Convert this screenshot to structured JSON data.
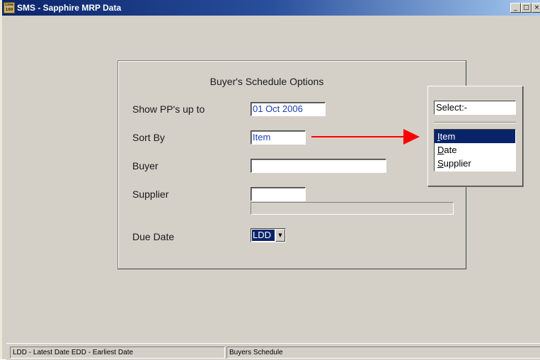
{
  "window": {
    "title": "SMS - Sapphire MRP Data",
    "icon_text": "Line 100",
    "controls": {
      "minimize": "_",
      "maximize": "□",
      "close": "×"
    }
  },
  "dialog": {
    "title": "Buyer's Schedule Options",
    "show_pp_label": "Show PP's up to",
    "show_pp_value": "01 Oct 2006",
    "sort_by_label": "Sort By",
    "sort_by_value": "Item",
    "buyer_label": "Buyer",
    "buyer_value": "",
    "supplier_label": "Supplier",
    "supplier_value": "",
    "supplier_name_value": "",
    "due_date_label": "Due Date",
    "due_date_value": "LDD"
  },
  "popup": {
    "header": "Select:-",
    "items": [
      "Item",
      "Date",
      "Supplier"
    ],
    "selected": "Item"
  },
  "annotation": {
    "arrow_color": "#ff0000"
  },
  "status": {
    "left": "LDD - Latest Date  EDD - Earliest Date",
    "right": "Buyers Schedule"
  }
}
